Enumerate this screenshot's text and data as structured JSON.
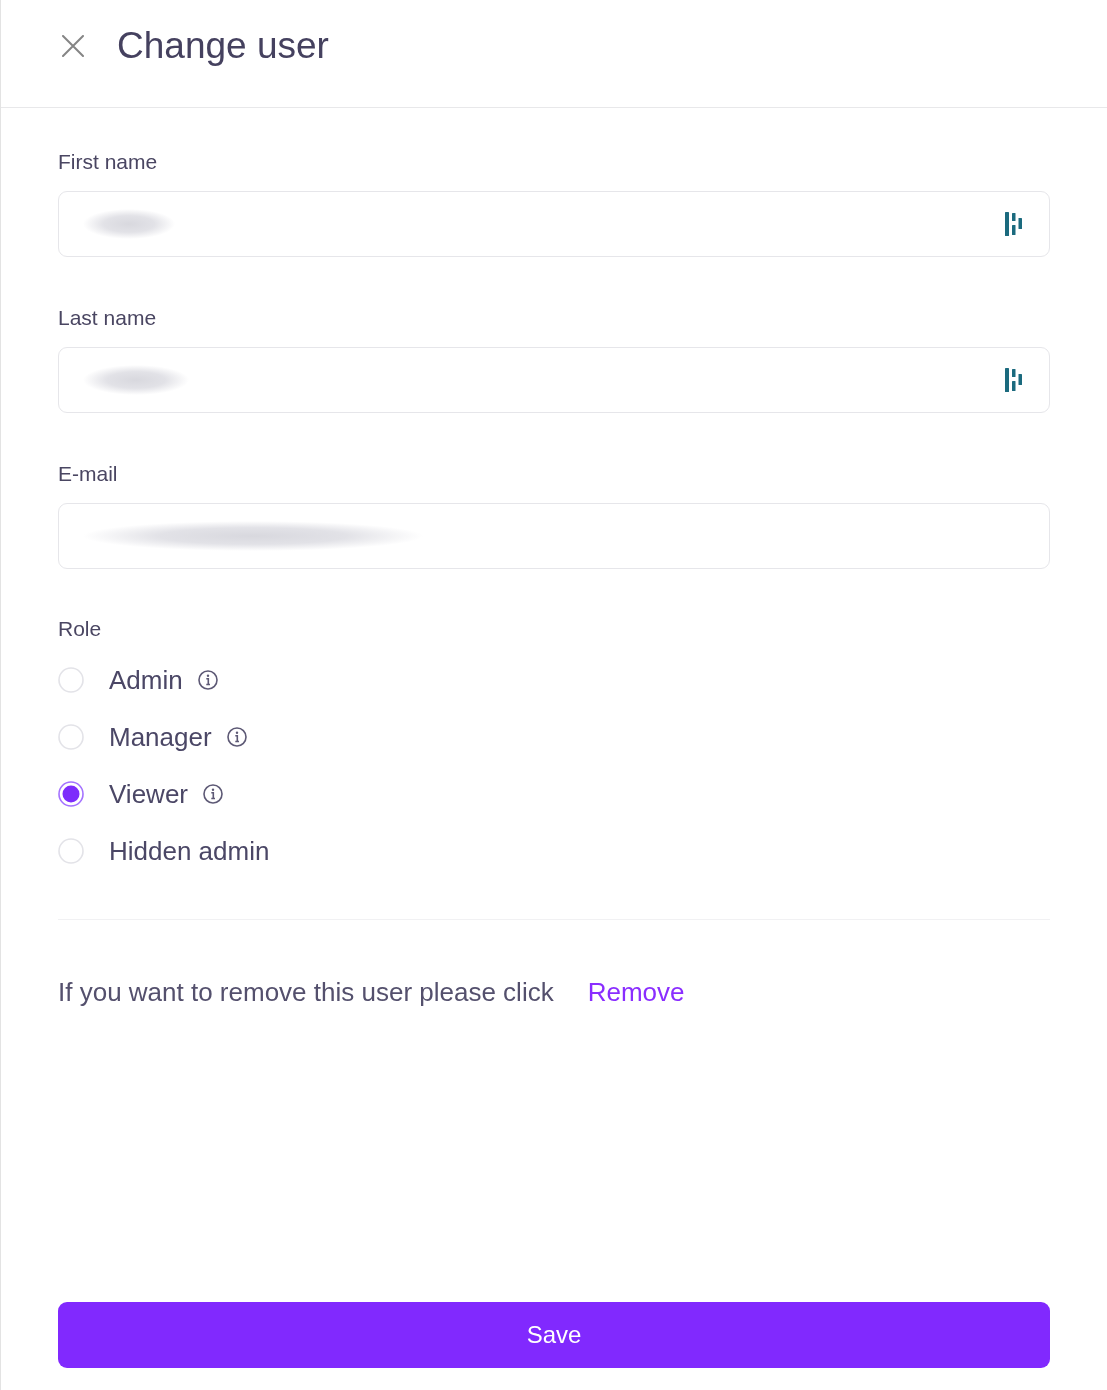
{
  "header": {
    "title": "Change user"
  },
  "fields": [
    {
      "label": "First name",
      "redacted": true,
      "side_icon": true
    },
    {
      "label": "Last name",
      "redacted": true,
      "side_icon": true
    },
    {
      "label": "E-mail",
      "redacted": true,
      "side_icon": false
    }
  ],
  "role": {
    "label": "Role",
    "options": [
      {
        "label": "Admin",
        "selected": false,
        "info": true
      },
      {
        "label": "Manager",
        "selected": false,
        "info": true
      },
      {
        "label": "Viewer",
        "selected": true,
        "info": true
      },
      {
        "label": "Hidden admin",
        "selected": false,
        "info": false
      }
    ]
  },
  "remove_notice": {
    "text": "If you want to remove this user please click",
    "link": "Remove"
  },
  "save_button": {
    "label": "Save"
  }
}
